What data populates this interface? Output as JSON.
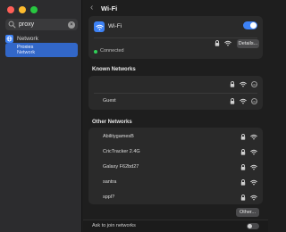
{
  "window": {
    "title": "Wi-Fi"
  },
  "sidebar": {
    "search": {
      "value": "proxy",
      "placeholder": "Search"
    },
    "items": [
      {
        "label": "Network",
        "icon": "globe-icon"
      },
      {
        "label": "Proxies",
        "sublabel": "Network",
        "selected": true
      }
    ]
  },
  "wifi": {
    "label": "Wi-Fi",
    "enabled": true,
    "status": "Connected",
    "details_label": "Details..."
  },
  "known_networks": {
    "title": "Known Networks",
    "items": [
      {
        "name": ""
      },
      {
        "name": "Guest"
      }
    ]
  },
  "other_networks": {
    "title": "Other Networks",
    "items": [
      {
        "name": "AbilitygamesB"
      },
      {
        "name": "CricTracker 2.4G"
      },
      {
        "name": "Galaxy F62bd27"
      },
      {
        "name": "santra"
      },
      {
        "name": "sppl?"
      }
    ],
    "other_label": "Other..."
  },
  "footer": {
    "ask_label": "Ask to join networks",
    "ask_enabled": false
  },
  "colors": {
    "accent": "#3d82f6",
    "connected": "#30d158",
    "selection": "#3267c8"
  }
}
